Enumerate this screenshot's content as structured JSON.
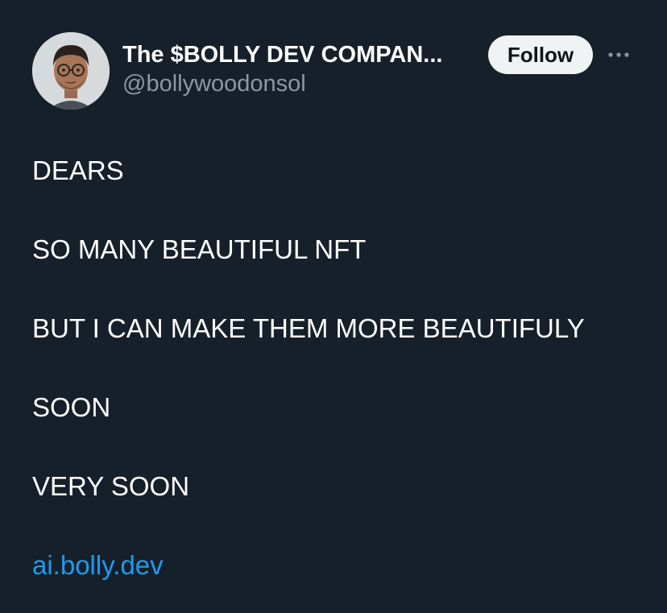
{
  "author": {
    "display_name": "The $BOLLY DEV COMPAN...",
    "handle": "@bollywoodonsol",
    "follow_label": "Follow"
  },
  "icons": {
    "more": "more-horizontal-icon",
    "avatar": "profile-photo"
  },
  "tweet": {
    "lines": [
      "DEARS",
      "SO MANY BEAUTIFUL NFT",
      "BUT I CAN MAKE THEM MORE BEAUTIFULY",
      "SOON",
      "VERY SOON"
    ],
    "link_text": "ai.bolly.dev"
  },
  "colors": {
    "background": "#16202a",
    "text": "#ffffff",
    "secondary": "#8b98a5",
    "link": "#1d9bf0",
    "follow_bg": "#eff3f4"
  }
}
